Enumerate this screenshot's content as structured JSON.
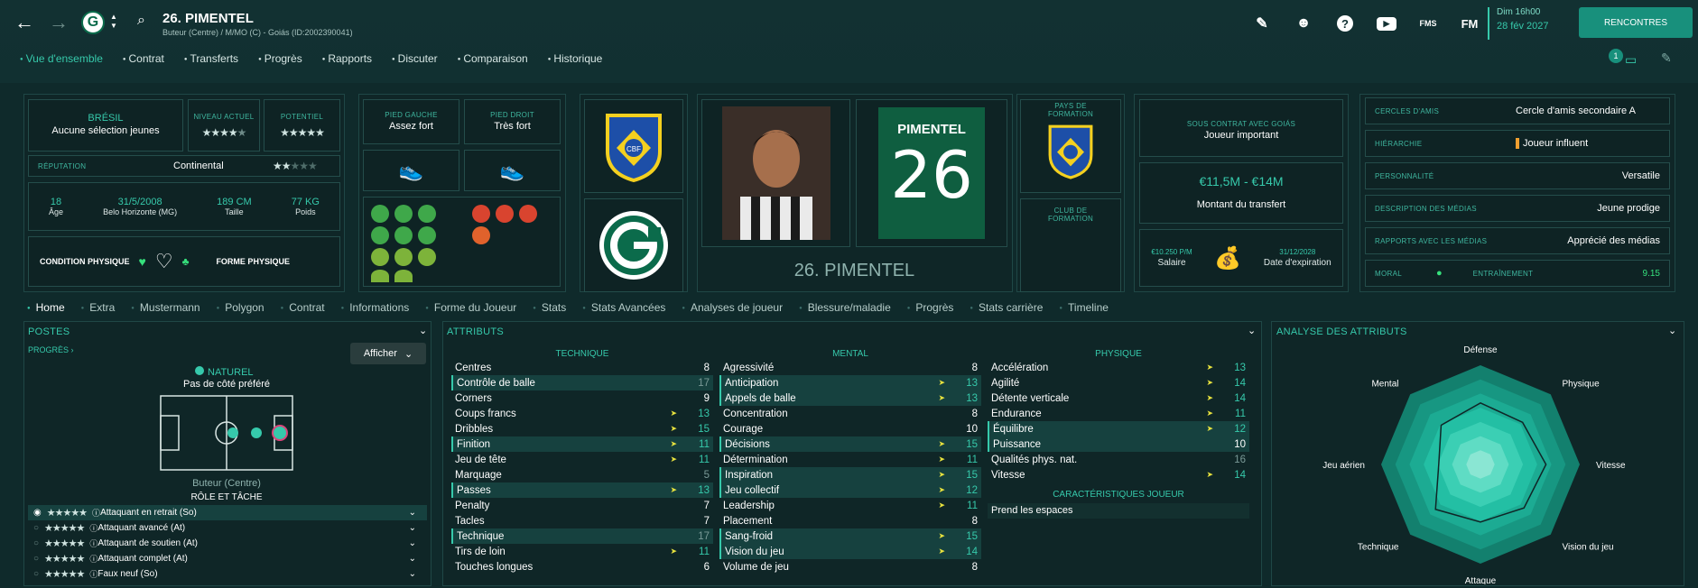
{
  "header": {
    "title": "26. PIMENTEL",
    "subtitle": "Buteur (Centre) / M/MO (C) - Goiás (ID:2002390041)",
    "date1": "Dim 16h00",
    "date2": "28 fév 2027",
    "rencontres": "RENCONTRES",
    "notif": "1"
  },
  "menu": [
    "Vue d'ensemble",
    "Contrat",
    "Transferts",
    "Progrès",
    "Rapports",
    "Discuter",
    "Comparaison",
    "Historique"
  ],
  "nation": {
    "country": "BRÉSIL",
    "selections": "Aucune sélection jeunes",
    "niveau_label": "NIVEAU ACTUEL",
    "potentiel_label": "POTENTIEL",
    "reputation_label": "RÉPUTATION",
    "reputation": "Continental"
  },
  "bio": {
    "age": "18",
    "age_label": "Âge",
    "birth": "31/5/2008",
    "birth_place": "Belo Horizonte (MG)",
    "height": "189 CM",
    "height_label": "Taille",
    "weight": "77 KG",
    "weight_label": "Poids",
    "condition": "CONDITION PHYSIQUE",
    "forme": "FORME PHYSIQUE"
  },
  "feet": {
    "left_label": "PIED GAUCHE",
    "left": "Assez fort",
    "right_label": "PIED DROIT",
    "right": "Très fort"
  },
  "player_name": "26. PIMENTEL",
  "shirt_name": "PIMENTEL",
  "shirt_number": "26",
  "formation": {
    "pays_label": "PAYS DE FORMATION",
    "club_label": "CLUB DE FORMATION"
  },
  "contract": {
    "status_label": "SOUS CONTRAT AVEC GOIÁS",
    "status": "Joueur important",
    "value": "€11,5M - €14M",
    "value_label": "Montant du transfert",
    "salary": "€10.250 P/M",
    "salary_label": "Salaire",
    "expiry": "31/12/2028",
    "expiry_label": "Date d'expiration"
  },
  "social": [
    {
      "k": "CERCLES D'AMIS",
      "v": "Cercle d'amis secondaire A"
    },
    {
      "k": "HIÉRARCHIE",
      "v": "Joueur influent"
    },
    {
      "k": "PERSONNALITÉ",
      "v": "Versatile"
    },
    {
      "k": "DESCRIPTION DES MÉDIAS",
      "v": "Jeune prodige"
    },
    {
      "k": "RAPPORTS AVEC LES MÉDIAS",
      "v": "Apprécié des médias"
    }
  ],
  "moral": {
    "label": "MORAL",
    "training_label": "ENTRAÎNEMENT",
    "training": "9.15"
  },
  "tabs": [
    "Home",
    "Extra",
    "Mustermann",
    "Polygon",
    "Contrat",
    "Informations",
    "Forme du Joueur",
    "Stats",
    "Stats Avancées",
    "Analyses de joueur",
    "Blessure/maladie",
    "Progrès",
    "Stats carrière",
    "Timeline"
  ],
  "postes": {
    "title": "POSTES",
    "progres": "PROGRÈS",
    "afficher": "Afficher",
    "naturel": "NATUREL",
    "side": "Pas de côté préféré",
    "position": "Buteur (Centre)",
    "role_title": "RÔLE ET TÂCHE",
    "roles": [
      "Attaquant en retrait (So)",
      "Attaquant avancé (At)",
      "Attaquant de soutien (At)",
      "Attaquant complet (At)",
      "Faux neuf (So)"
    ]
  },
  "attributes": {
    "title": "ATTRIBUTS",
    "technique_label": "TECHNIQUE",
    "mental_label": "MENTAL",
    "physique_label": "PHYSIQUE",
    "carac_label": "CARACTÉRISTIQUES JOUEUR",
    "carac": "Prend les espaces",
    "technique": [
      [
        "Centres",
        "8",
        "",
        ""
      ],
      [
        "Contrôle de balle",
        "17",
        "hl",
        "grey"
      ],
      [
        "Corners",
        "9",
        "",
        ""
      ],
      [
        "Coups francs",
        "13",
        "",
        "teal"
      ],
      [
        "Dribbles",
        "15",
        "",
        "teal"
      ],
      [
        "Finition",
        "11",
        "hl",
        "teal"
      ],
      [
        "Jeu de tête",
        "11",
        "",
        "teal"
      ],
      [
        "Marquage",
        "5",
        "",
        "grey"
      ],
      [
        "Passes",
        "13",
        "hl",
        "teal"
      ],
      [
        "Penalty",
        "7",
        "",
        ""
      ],
      [
        "Tacles",
        "7",
        "",
        ""
      ],
      [
        "Technique",
        "17",
        "hl",
        "grey"
      ],
      [
        "Tirs de loin",
        "11",
        "",
        "teal"
      ],
      [
        "Touches longues",
        "6",
        "",
        ""
      ]
    ],
    "mental": [
      [
        "Agressivité",
        "8",
        "",
        ""
      ],
      [
        "Anticipation",
        "13",
        "hl",
        "teal"
      ],
      [
        "Appels de balle",
        "13",
        "hl",
        "teal"
      ],
      [
        "Concentration",
        "8",
        "",
        ""
      ],
      [
        "Courage",
        "10",
        "",
        ""
      ],
      [
        "Décisions",
        "15",
        "hl",
        "teal"
      ],
      [
        "Détermination",
        "11",
        "",
        "teal"
      ],
      [
        "Inspiration",
        "15",
        "hl",
        "teal"
      ],
      [
        "Jeu collectif",
        "12",
        "hl",
        "teal"
      ],
      [
        "Leadership",
        "11",
        "",
        "teal"
      ],
      [
        "Placement",
        "8",
        "",
        ""
      ],
      [
        "Sang-froid",
        "15",
        "hl",
        "teal"
      ],
      [
        "Vision du jeu",
        "14",
        "hl",
        "teal"
      ],
      [
        "Volume de jeu",
        "8",
        "",
        ""
      ]
    ],
    "physique": [
      [
        "Accélération",
        "13",
        "",
        "teal"
      ],
      [
        "Agilité",
        "14",
        "",
        "teal"
      ],
      [
        "Détente verticale",
        "14",
        "",
        "teal"
      ],
      [
        "Endurance",
        "11",
        "",
        "teal"
      ],
      [
        "Équilibre",
        "12",
        "hl",
        "teal"
      ],
      [
        "Puissance",
        "10",
        "hl",
        ""
      ],
      [
        "Qualités phys. nat.",
        "16",
        "",
        "grey"
      ],
      [
        "Vitesse",
        "14",
        "",
        "teal"
      ]
    ]
  },
  "radar": {
    "title": "ANALYSE DES ATTRIBUTS",
    "labels": [
      "Défense",
      "Physique",
      "Vitesse",
      "Vision du jeu",
      "Attaque",
      "Technique",
      "Jeu aérien",
      "Mental"
    ]
  }
}
